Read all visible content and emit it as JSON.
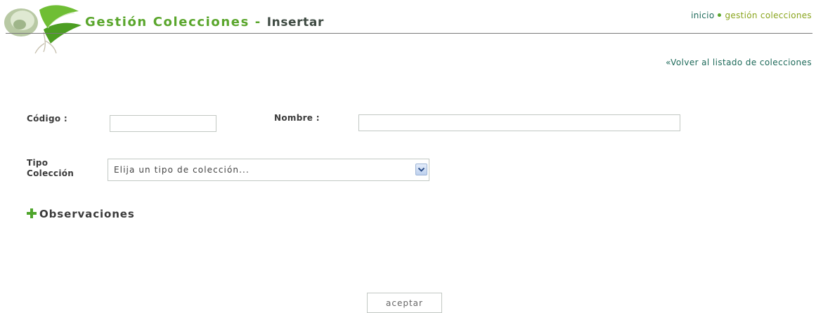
{
  "header": {
    "title_main": "Gestión Colecciones",
    "title_sep": " - ",
    "title_sub": "Insertar",
    "logo_icon": "leaves-logo-icon"
  },
  "topnav": {
    "home": "inicio",
    "current": "gestión colecciones"
  },
  "back_link": "«Volver al listado de colecciones",
  "form": {
    "codigo_label": "Código :",
    "codigo_value": "",
    "nombre_label": "Nombre :",
    "nombre_value": "",
    "tipo_label_1": "Tipo",
    "tipo_label_2": "Colección",
    "tipo_selected": "Elija un tipo de colección...",
    "observaciones_label": "Observaciones",
    "submit_label": "aceptar"
  },
  "colors": {
    "title_green": "#5aa62c",
    "link_teal": "#1e6a5a",
    "nav_active": "#8aa51e"
  }
}
